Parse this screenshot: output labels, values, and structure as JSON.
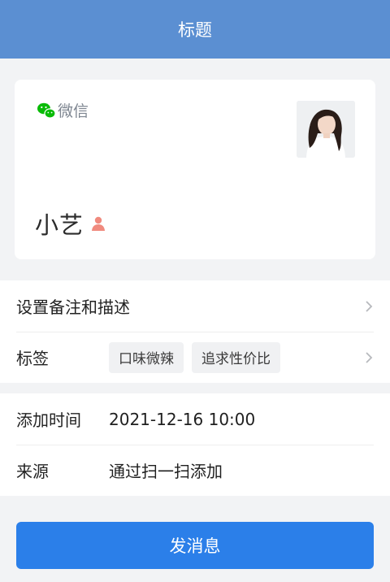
{
  "header": {
    "title": "标题"
  },
  "card": {
    "source_label": "微信",
    "source_icon": "wechat-icon",
    "name": "小艺",
    "gender_icon": "person-icon",
    "avatar": "avatar-photo"
  },
  "info": {
    "remark_label": "设置备注和描述",
    "tags_label": "标签",
    "tags": [
      "口味微辣",
      "追求性价比"
    ]
  },
  "details": {
    "added_time_label": "添加时间",
    "added_time_value": "2021-12-16 10:00",
    "source_label": "来源",
    "source_value": "通过扫一扫添加"
  },
  "actions": {
    "send_message_label": "发消息"
  },
  "colors": {
    "header": "#5b8fd2",
    "primary": "#2b7fe9",
    "wechat": "#09bb07",
    "gender": "#f08a7e"
  }
}
